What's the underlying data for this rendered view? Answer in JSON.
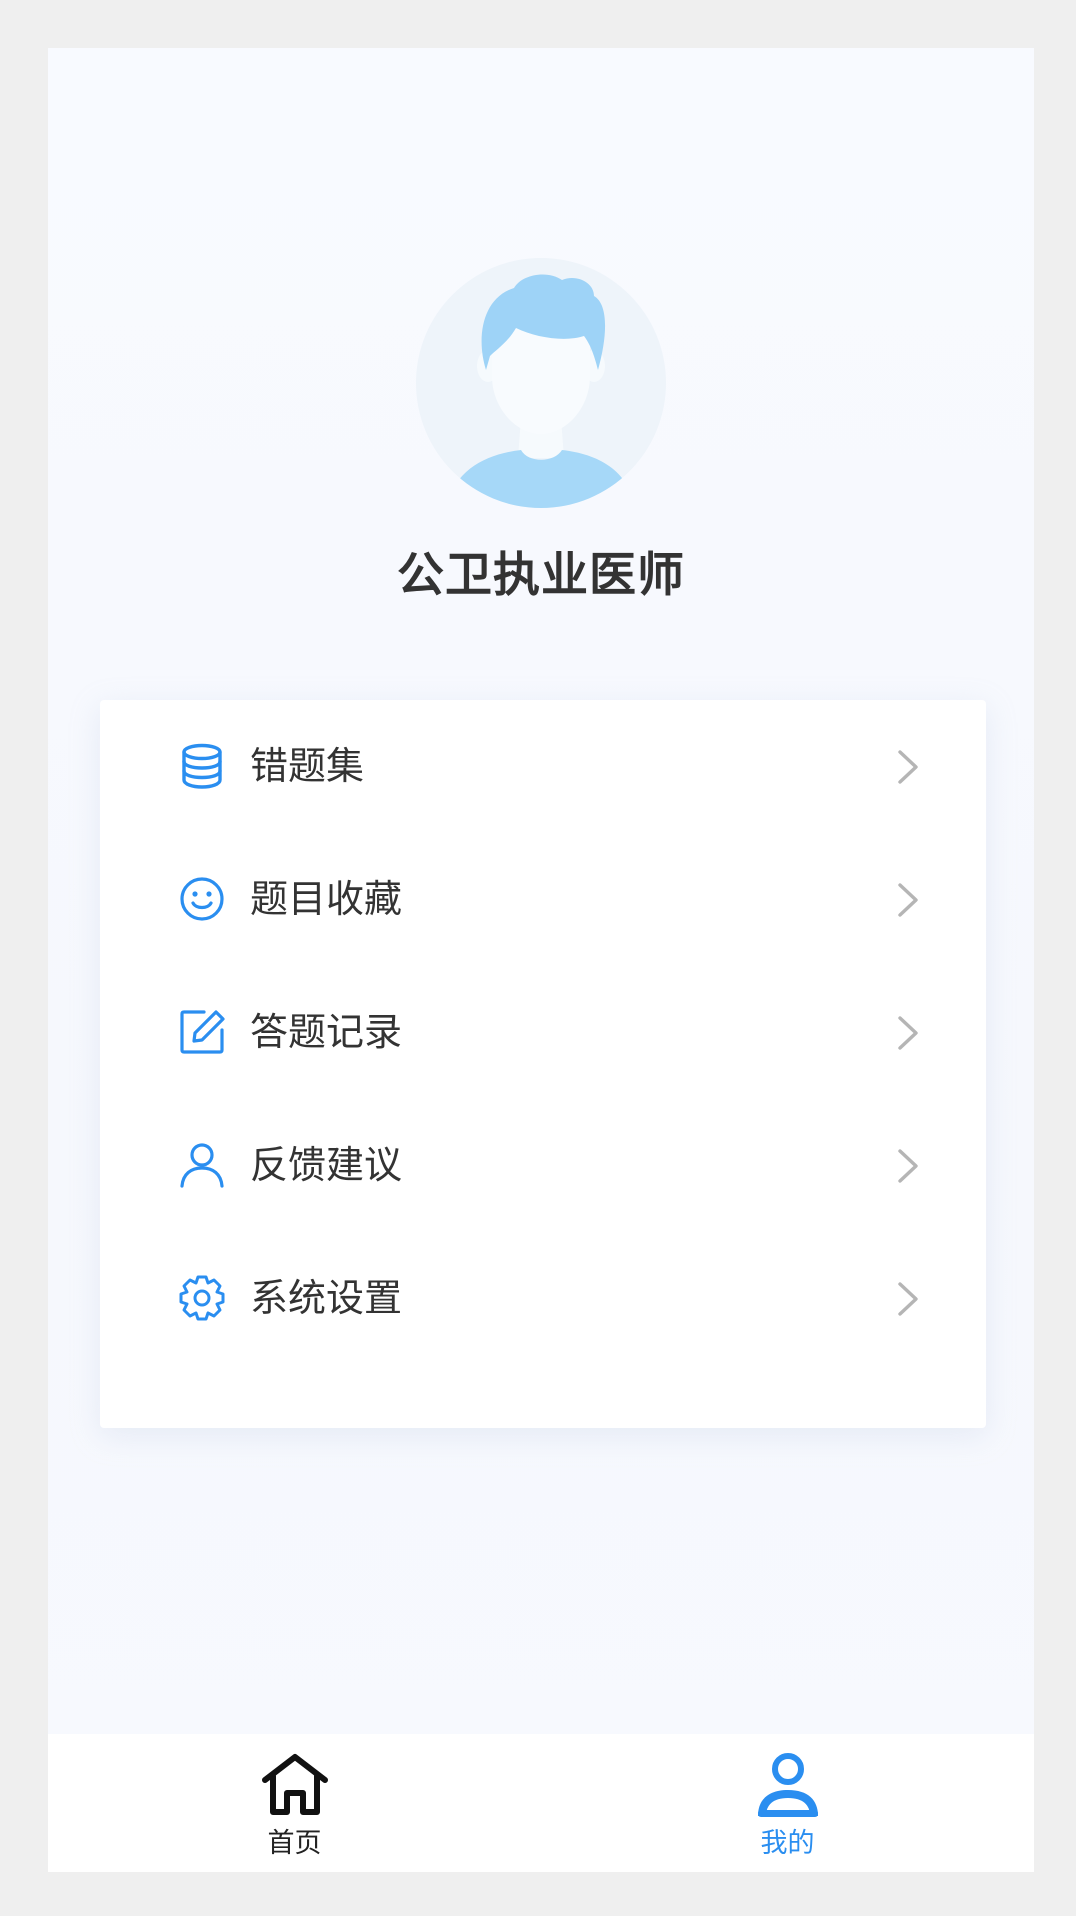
{
  "profile": {
    "name": "公卫执业医师"
  },
  "menu": {
    "items": [
      {
        "label": "错题集",
        "icon": "database-icon"
      },
      {
        "label": "题目收藏",
        "icon": "smile-icon"
      },
      {
        "label": "答题记录",
        "icon": "edit-icon"
      },
      {
        "label": "反馈建议",
        "icon": "user-icon"
      },
      {
        "label": "系统设置",
        "icon": "gear-icon"
      }
    ]
  },
  "tabbar": {
    "tabs": [
      {
        "label": "首页",
        "icon": "home-icon",
        "active": false
      },
      {
        "label": "我的",
        "icon": "user-filled-icon",
        "active": true
      }
    ]
  },
  "colors": {
    "accent": "#2a8ef0",
    "text_primary": "#333333",
    "tab_inactive": "#222222",
    "tab_active": "#2a8ef0",
    "chevron": "#b5b5b5",
    "avatar_hair": "#9ed3f7",
    "avatar_shirt": "#a6d8f8"
  }
}
